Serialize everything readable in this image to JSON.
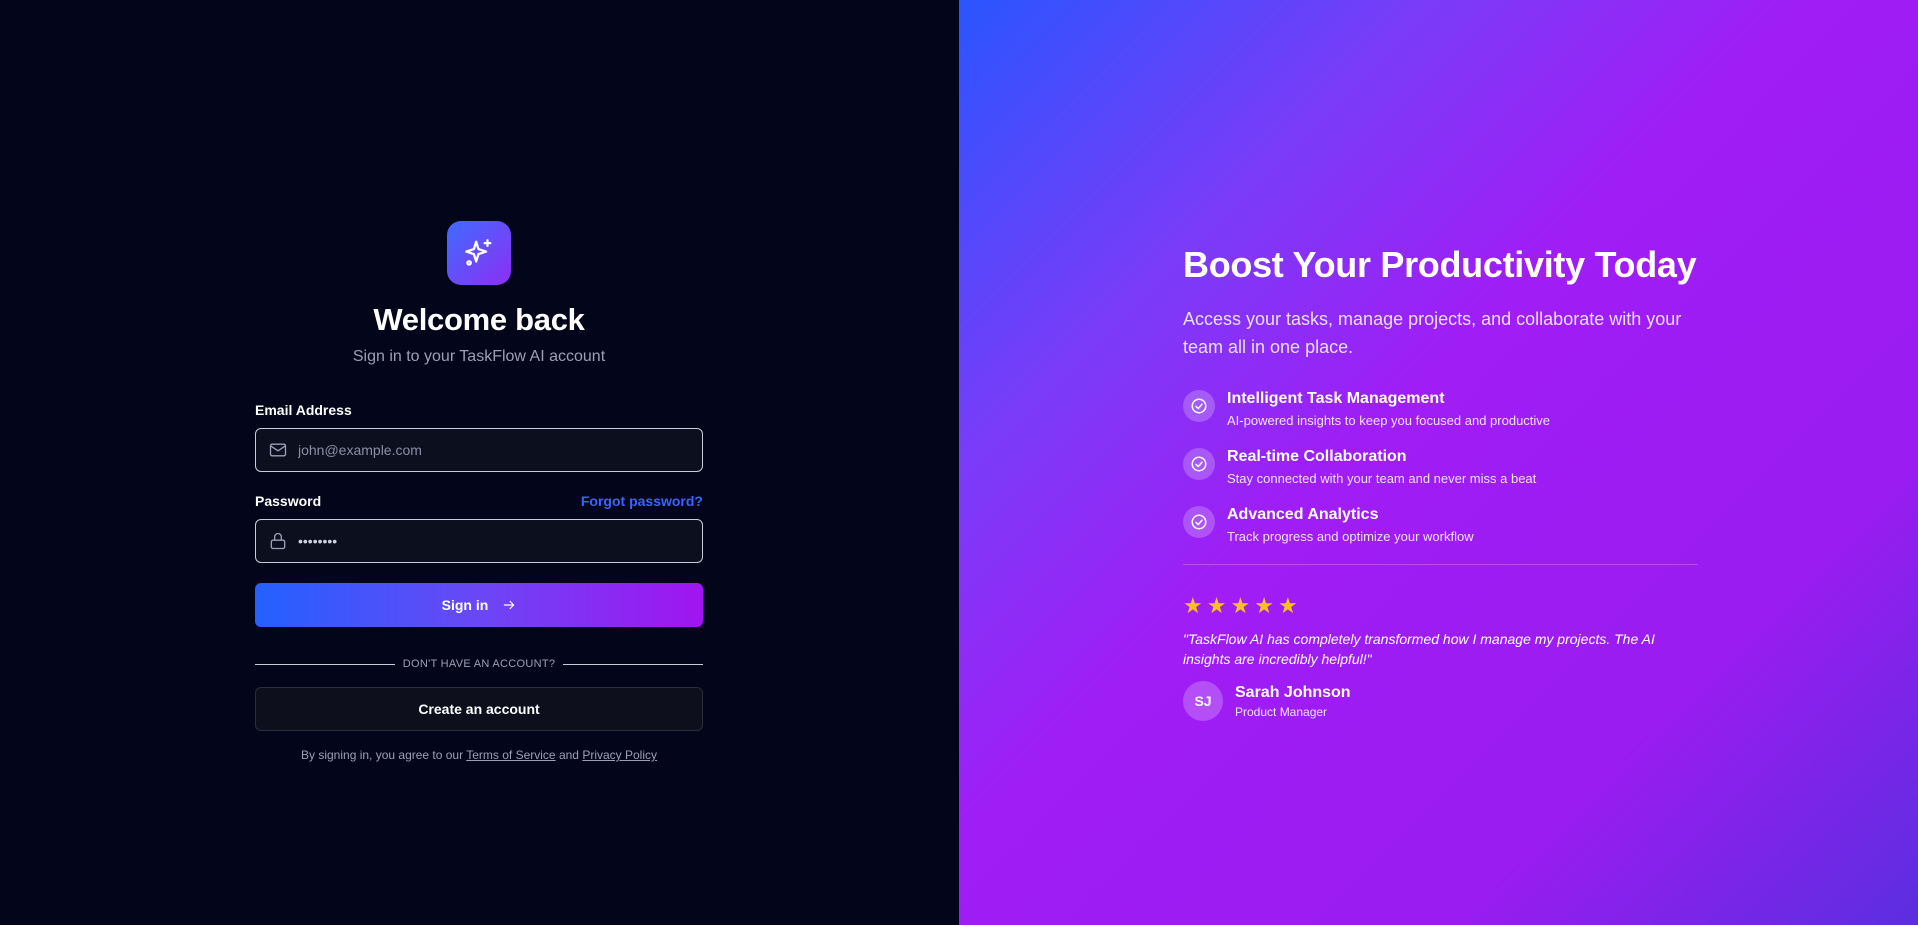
{
  "login": {
    "logo_icon": "sparkles-icon",
    "title": "Welcome back",
    "subtitle": "Sign in to your TaskFlow AI account",
    "email": {
      "label": "Email Address",
      "placeholder": "john@example.com",
      "icon": "mail-icon"
    },
    "password": {
      "label": "Password",
      "value": "••••••••",
      "icon": "lock-icon",
      "forgot_label": "Forgot password?"
    },
    "signin_label": "Sign in",
    "divider_text": "DON'T HAVE AN ACCOUNT?",
    "create_label": "Create an account",
    "terms": {
      "prefix": "By signing in, you agree to our",
      "tos": "Terms of Service",
      "and": "and",
      "privacy": "Privacy Policy"
    }
  },
  "promo": {
    "title": "Boost Your Productivity Today",
    "subtitle": "Access your tasks, manage projects, and collaborate with your team all in one place.",
    "features": [
      {
        "title": "Intelligent Task Management",
        "desc": "AI-powered insights to keep you focused and productive"
      },
      {
        "title": "Real-time Collaboration",
        "desc": "Stay connected with your team and never miss a beat"
      },
      {
        "title": "Advanced Analytics",
        "desc": "Track progress and optimize your workflow"
      }
    ],
    "rating": 5,
    "quote": "\"TaskFlow AI has completely transformed how I manage my projects. The AI insights are incredibly helpful!\"",
    "reviewer": {
      "initials": "SJ",
      "name": "Sarah Johnson",
      "role": "Product Manager"
    }
  },
  "colors": {
    "accent_blue": "#3b63ff",
    "accent_purple": "#a114f0",
    "star": "#f9c120",
    "background": "#03051a"
  }
}
